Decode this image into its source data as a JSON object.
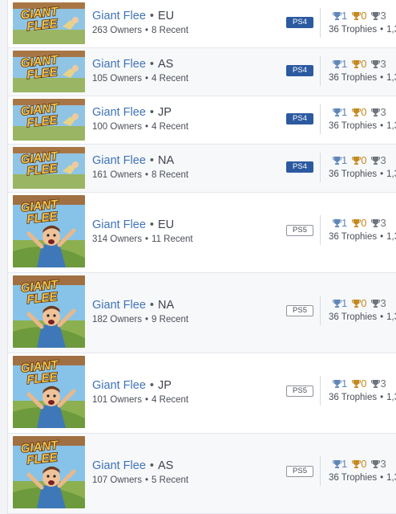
{
  "rows": [
    {
      "name": "Giant Flee",
      "region": "EU",
      "owners": "263 Owners",
      "recent": "8 Recent",
      "platform": "PS4",
      "platinum": "1",
      "gold": "0",
      "silver": "3",
      "trophies": "36 Trophies",
      "points": "1,3"
    },
    {
      "name": "Giant Flee",
      "region": "AS",
      "owners": "105 Owners",
      "recent": "4 Recent",
      "platform": "PS4",
      "platinum": "1",
      "gold": "0",
      "silver": "3",
      "trophies": "36 Trophies",
      "points": "1,3"
    },
    {
      "name": "Giant Flee",
      "region": "JP",
      "owners": "100 Owners",
      "recent": "4 Recent",
      "platform": "PS4",
      "platinum": "1",
      "gold": "0",
      "silver": "3",
      "trophies": "36 Trophies",
      "points": "1,3"
    },
    {
      "name": "Giant Flee",
      "region": "NA",
      "owners": "161 Owners",
      "recent": "8 Recent",
      "platform": "PS4",
      "platinum": "1",
      "gold": "0",
      "silver": "3",
      "trophies": "36 Trophies",
      "points": "1,3"
    },
    {
      "name": "Giant Flee",
      "region": "EU",
      "owners": "314 Owners",
      "recent": "11 Recent",
      "platform": "PS5",
      "platinum": "1",
      "gold": "0",
      "silver": "3",
      "trophies": "36 Trophies",
      "points": "1,3"
    },
    {
      "name": "Giant Flee",
      "region": "NA",
      "owners": "182 Owners",
      "recent": "9 Recent",
      "platform": "PS5",
      "platinum": "1",
      "gold": "0",
      "silver": "3",
      "trophies": "36 Trophies",
      "points": "1,3"
    },
    {
      "name": "Giant Flee",
      "region": "JP",
      "owners": "101 Owners",
      "recent": "4 Recent",
      "platform": "PS5",
      "platinum": "1",
      "gold": "0",
      "silver": "3",
      "trophies": "36 Trophies",
      "points": "1,3"
    },
    {
      "name": "Giant Flee",
      "region": "AS",
      "owners": "107 Owners",
      "recent": "5 Recent",
      "platform": "PS5",
      "platinum": "1",
      "gold": "0",
      "silver": "3",
      "trophies": "36 Trophies",
      "points": "1,3"
    }
  ],
  "logo_text": {
    "line1": "GIANT",
    "line2": "FLEE"
  },
  "icons": {
    "thumbnail": "game-cover-icon",
    "platinum": "platinum-trophy-icon",
    "gold": "gold-trophy-icon",
    "silver": "silver-trophy-icon"
  },
  "colors": {
    "link": "#3f73b6",
    "ps4_badge": "#2c5aa0",
    "platinum": "#5f86b8",
    "gold": "#c38a22",
    "silver": "#6e747c"
  }
}
